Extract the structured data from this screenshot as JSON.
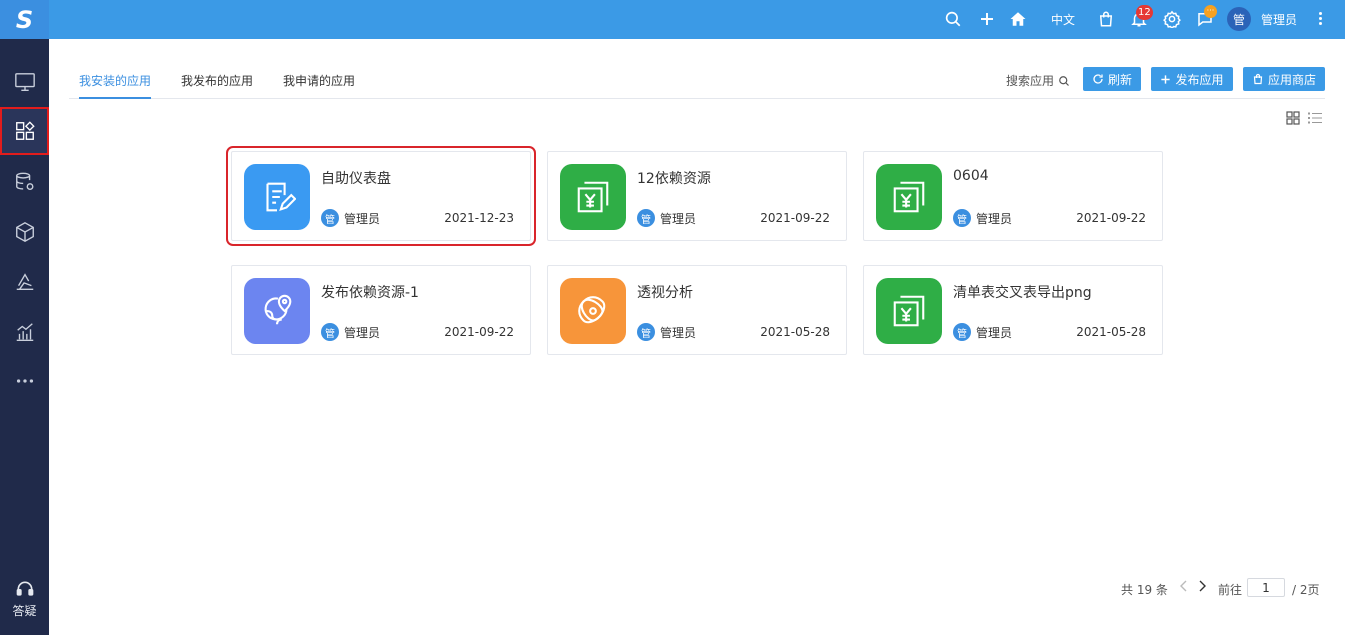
{
  "logo": {
    "text": "S"
  },
  "sidebar": {
    "items": [
      {
        "name": "monitor-icon"
      },
      {
        "name": "apps-icon",
        "active": true
      },
      {
        "name": "database-gear-icon"
      },
      {
        "name": "cube-icon"
      },
      {
        "name": "layers-icon"
      },
      {
        "name": "bar-chart-icon"
      },
      {
        "name": "more-dots-icon"
      }
    ],
    "help_label": "答疑"
  },
  "topbar": {
    "language": "中文",
    "notification_count": "12",
    "message_badge": "···",
    "avatar_text": "管",
    "user_name": "管理员"
  },
  "tabs": [
    {
      "label": "我安装的应用",
      "active": true
    },
    {
      "label": "我发布的应用",
      "active": false
    },
    {
      "label": "我申请的应用",
      "active": false
    }
  ],
  "toolbar": {
    "search_label": "搜索应用",
    "refresh_label": "刷新",
    "publish_label": "发布应用",
    "store_label": "应用商店"
  },
  "apps": [
    {
      "title": "自助仪表盘",
      "owner_badge": "管",
      "owner": "管理员",
      "date": "2021-12-23",
      "icon": "dashboard-edit-icon",
      "color": "#3a9af2"
    },
    {
      "title": "12依赖资源",
      "owner_badge": "管",
      "owner": "管理员",
      "date": "2021-09-22",
      "icon": "yen-doc-icon",
      "color": "#2fae46"
    },
    {
      "title": "0604",
      "owner_badge": "管",
      "owner": "管理员",
      "date": "2021-09-22",
      "icon": "yen-doc-icon",
      "color": "#2fae46"
    },
    {
      "title": "发布依赖资源-1",
      "owner_badge": "管",
      "owner": "管理员",
      "date": "2021-09-22",
      "icon": "globe-pin-icon",
      "color": "#6c85f0"
    },
    {
      "title": "透视分析",
      "owner_badge": "管",
      "owner": "管理员",
      "date": "2021-05-28",
      "icon": "atom-icon",
      "color": "#f7953a"
    },
    {
      "title": "清单表交叉表导出png",
      "owner_badge": "管",
      "owner": "管理员",
      "date": "2021-05-28",
      "icon": "yen-doc-icon",
      "color": "#2fae46"
    }
  ],
  "pagination": {
    "total": "共 19 条",
    "goto_label": "前往",
    "current_page": "1",
    "pages_label": "/ 2页"
  }
}
